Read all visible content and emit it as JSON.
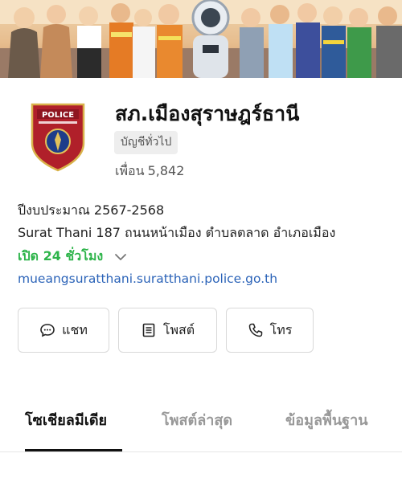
{
  "cover": {
    "image": "cartoon-workers-banner"
  },
  "profile": {
    "badge_text": "POLICE",
    "name": "สภ.เมืองสุราษฎร์ธานี",
    "account_type": "บัญชีทั่วไป",
    "friends_label": "เพื่อน",
    "friends_count": "5,842"
  },
  "info": {
    "fiscal_year": "ปีงบประมาณ 2567-2568",
    "address": "Surat Thani 187 ถนนหน้าเมือง ตำบลตลาด อำเภอเมือง",
    "hours": "เปิด 24 ชั่วโมง",
    "website": "mueangsuratthani.suratthani.police.go.th"
  },
  "actions": {
    "chat": {
      "label": "แชท",
      "icon": "chat-bubble-icon"
    },
    "post": {
      "label": "โพสต์",
      "icon": "post-icon"
    },
    "call": {
      "label": "โทร",
      "icon": "phone-icon"
    }
  },
  "tabs": [
    {
      "label": "โซเชียลมีเดีย",
      "active": true
    },
    {
      "label": "โพสต์ล่าสุด",
      "active": false
    },
    {
      "label": "ข้อมูลพื้นฐาน",
      "active": false
    }
  ],
  "colors": {
    "hours_green": "#2db44a",
    "link_blue": "#2b63b8",
    "badge_red": "#b0202a"
  }
}
